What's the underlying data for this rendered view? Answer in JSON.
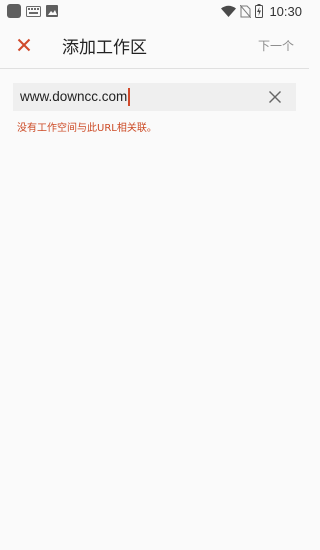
{
  "status_bar": {
    "time": "10:30",
    "icons": [
      "square-icon",
      "keyboard-icon",
      "image-icon",
      "wifi-icon",
      "no-sim-icon",
      "battery-charging-icon"
    ]
  },
  "app_bar": {
    "close_icon": "close-icon",
    "title": "添加工作区",
    "next_label": "下一个"
  },
  "url_field": {
    "value": "www.downcc.com",
    "clear_icon": "clear-icon"
  },
  "error": {
    "message": "没有工作空间与此URL相关联。"
  },
  "colors": {
    "accent": "#d04a2b",
    "background": "#fafafa",
    "field_bg": "#efefef",
    "error": "#cc4a25",
    "next_disabled": "#8d8d8d"
  }
}
